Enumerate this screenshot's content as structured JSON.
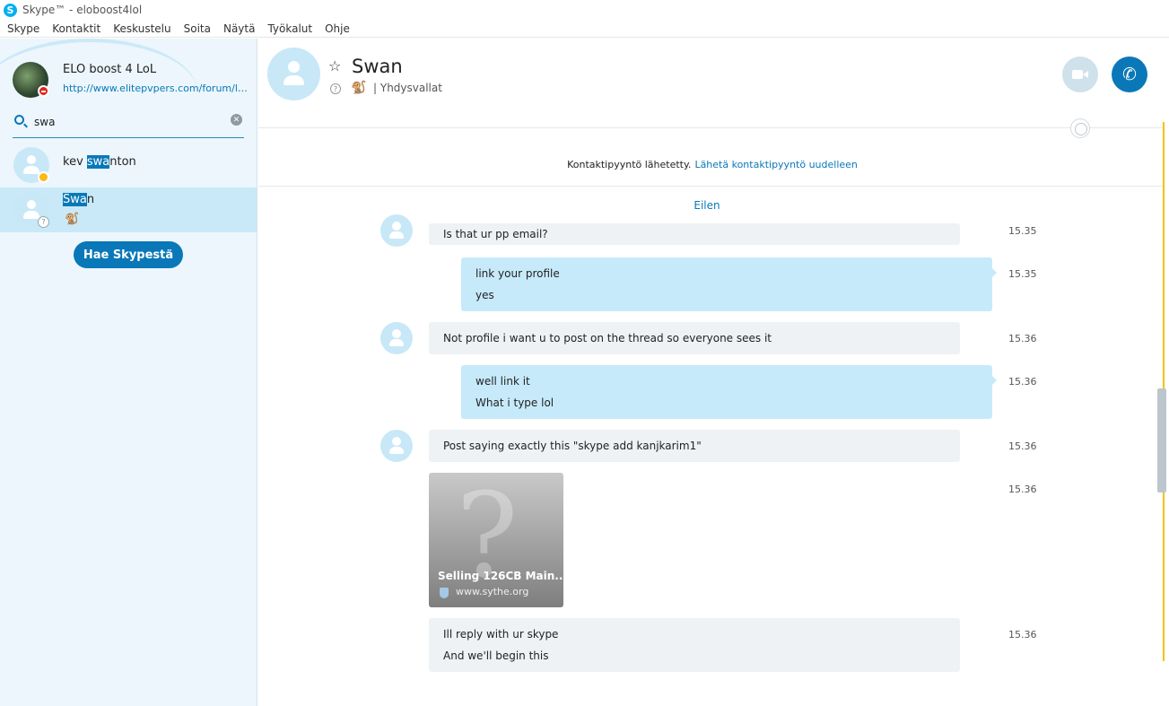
{
  "window": {
    "title": "Skype™ - eloboost4lol"
  },
  "menu": [
    "Skype",
    "Kontaktit",
    "Keskustelu",
    "Soita",
    "Näytä",
    "Työkalut",
    "Ohje"
  ],
  "profile": {
    "name": "ELO boost 4 LoL",
    "mood": "http://www.elitepvpers.com/forum/le...",
    "status": "do-not-disturb"
  },
  "search": {
    "query": "swa"
  },
  "results": [
    {
      "pre": "kev ",
      "match": "swa",
      "post": "nton",
      "status": "away",
      "extra": ""
    },
    {
      "pre": "",
      "match": "Swa",
      "post": "n",
      "status": "unknown",
      "extra": "🐒"
    }
  ],
  "search_skype_button": "Hae Skypestä",
  "conversation": {
    "name": "Swan",
    "location": "Yhdysvallat",
    "mood_emoticon": "🐒",
    "status_icon": "?",
    "contact_request": {
      "text": "Kontaktipyyntö lähetetty.",
      "link": "Lähetä kontaktipyyntö uudelleen"
    },
    "day_separator": "Eilen",
    "messages": [
      {
        "dir": "in",
        "lines": [
          "Is that ur pp email?"
        ],
        "time": "15.35"
      },
      {
        "dir": "out",
        "lines": [
          "link your profile",
          "yes"
        ],
        "time": "15.35"
      },
      {
        "dir": "in",
        "lines": [
          "Not profile i want u to post on the thread so everyone sees it"
        ],
        "time": "15.36"
      },
      {
        "dir": "out",
        "lines": [
          "well link it",
          "What i type lol"
        ],
        "time": "15.36"
      },
      {
        "dir": "in",
        "lines": [
          "Post saying exactly this \"skype add kanjkarim1\""
        ],
        "time": "15.36"
      },
      {
        "dir": "in",
        "card": true,
        "time": "15.36"
      },
      {
        "dir": "in",
        "lines": [
          "Ill reply with ur skype",
          "And we'll begin this"
        ],
        "time": "15.36"
      }
    ],
    "link_card": {
      "title": "Selling 126CB Main...",
      "domain": "www.sythe.org"
    }
  },
  "colors": {
    "accent": "#0a78b8",
    "outgoing_bubble": "#c7eafb",
    "incoming_bubble": "#eef2f5",
    "sidebar": "#ecf6fc"
  }
}
